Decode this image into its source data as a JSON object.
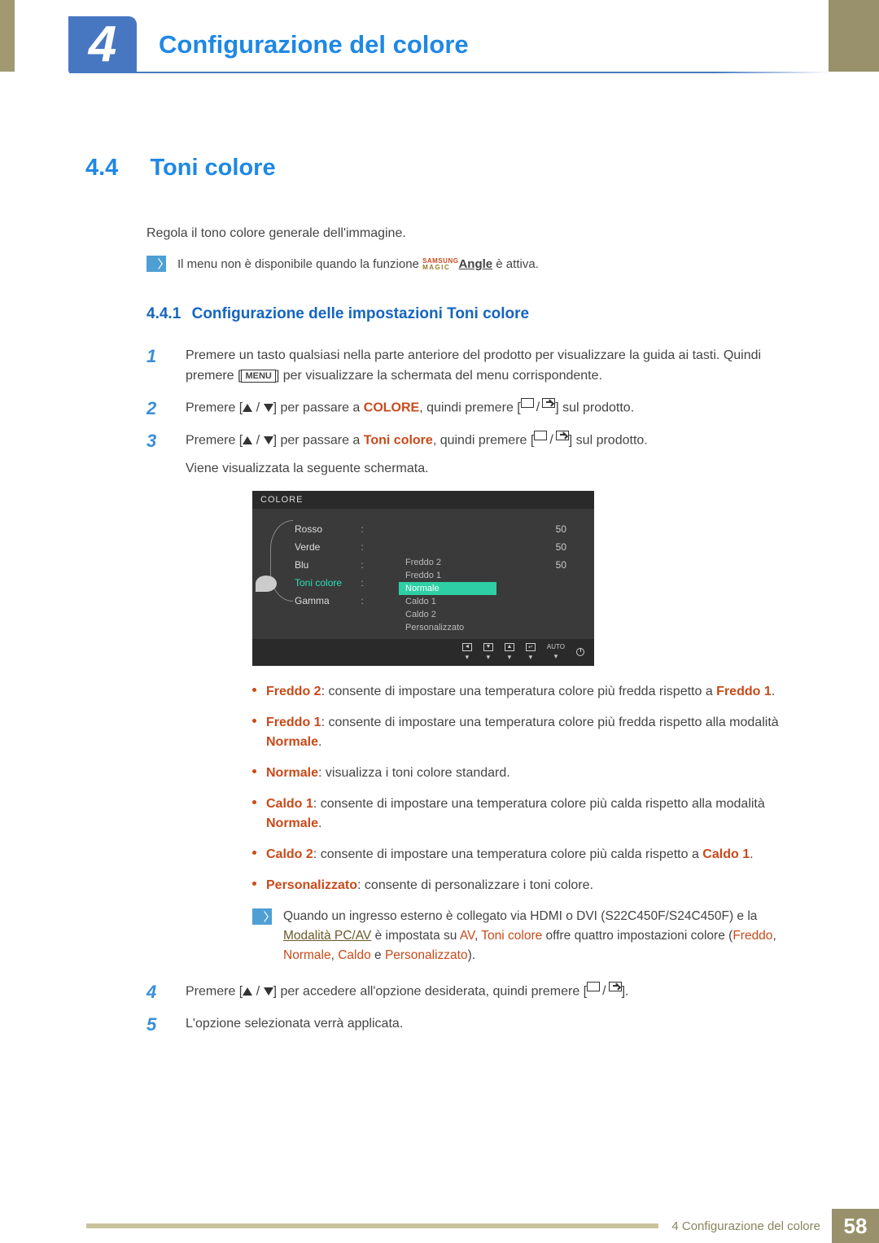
{
  "chapter": {
    "number": "4",
    "title": "Configurazione del colore"
  },
  "section": {
    "number": "4.4",
    "title": "Toni colore"
  },
  "intro_text": "Regola il tono colore generale dell'immagine.",
  "top_note": {
    "before": "Il menu non è disponibile quando la funzione ",
    "angle_label": "Angle",
    "after": " è attiva."
  },
  "subsection": {
    "number": "4.4.1",
    "title": "Configurazione delle impostazioni Toni colore"
  },
  "steps": {
    "s1": {
      "num": "1",
      "a": "Premere un tasto qualsiasi nella parte anteriore del prodotto per visualizzare la guida ai tasti. Quindi premere [",
      "menu": "MENU",
      "b": "] per visualizzare la schermata del menu corrispondente."
    },
    "s2": {
      "num": "2",
      "a": "Premere [",
      "b": "] per passare a ",
      "target": "COLORE",
      "c": ", quindi premere [",
      "d": "] sul prodotto."
    },
    "s3": {
      "num": "3",
      "a": "Premere [",
      "b": "] per passare a ",
      "target": "Toni colore",
      "c": ", quindi premere [",
      "d": "] sul prodotto.",
      "e": "Viene visualizzata la seguente schermata."
    },
    "s4": {
      "num": "4",
      "a": "Premere [",
      "b": "] per accedere all'opzione desiderata, quindi premere [",
      "c": "]."
    },
    "s5": {
      "num": "5",
      "text": "L'opzione selezionata verrà applicata."
    }
  },
  "osd": {
    "title": "COLORE",
    "rows": [
      {
        "label": "Rosso",
        "value": "50"
      },
      {
        "label": "Verde",
        "value": "50"
      },
      {
        "label": "Blu",
        "value": "50"
      },
      {
        "label": "Toni colore",
        "value": ""
      },
      {
        "label": "Gamma",
        "value": ""
      }
    ],
    "sublist": [
      "Freddo 2",
      "Freddo 1",
      "Normale",
      "Caldo 1",
      "Caldo 2",
      "Personalizzato"
    ],
    "selected_sub": "Normale",
    "footer_auto": "AUTO"
  },
  "bullets": {
    "b1": {
      "name": "Freddo 2",
      "text": ": consente di impostare una temperatura colore più fredda rispetto a ",
      "ref": "Freddo 1",
      "tail": "."
    },
    "b2": {
      "name": "Freddo 1",
      "text": ": consente di impostare una temperatura colore più fredda rispetto alla modalità ",
      "ref": "Normale",
      "tail": "."
    },
    "b3": {
      "name": "Normale",
      "text": ": visualizza i toni colore standard."
    },
    "b4": {
      "name": "Caldo 1",
      "text": ": consente di impostare una temperatura colore più calda rispetto alla modalità ",
      "ref": "Normale",
      "tail": "."
    },
    "b5": {
      "name": "Caldo 2",
      "text": ": consente di impostare una temperatura colore più calda rispetto a ",
      "ref": "Caldo 1",
      "tail": "."
    },
    "b6": {
      "name": "Personalizzato",
      "text": ": consente di personalizzare i toni colore."
    }
  },
  "note2": {
    "a": "Quando un ingresso esterno è collegato via HDMI o DVI (S22C450F/S24C450F) e la ",
    "link": "Modalità PC/AV",
    "b": " è impostata su ",
    "av": "AV",
    "c": ", ",
    "toni": "Toni colore",
    "d": " offre quattro impostazioni colore (",
    "opt1": "Freddo",
    "sep": ", ",
    "opt2": "Normale",
    "opt3": "Caldo",
    "e": " e ",
    "opt4": "Personalizzato",
    "tail": ")."
  },
  "footer": {
    "text": "4 Configurazione del colore",
    "page": "58"
  }
}
